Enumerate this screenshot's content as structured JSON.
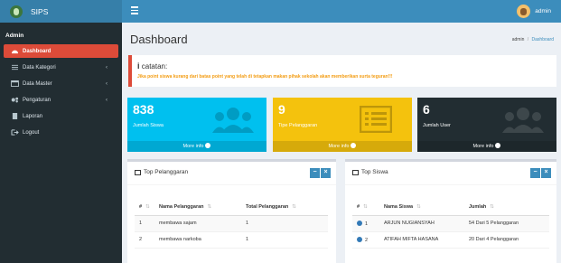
{
  "app": {
    "name": "SIPS"
  },
  "sidebar": {
    "header": "Admin",
    "items": [
      {
        "label": "Dashboard",
        "icon": "dashboard-icon"
      },
      {
        "label": "Data Kategori",
        "icon": "list-icon"
      },
      {
        "label": "Data Master",
        "icon": "table-icon"
      },
      {
        "label": "Pengaturan",
        "icon": "gears-icon"
      },
      {
        "label": "Laporan",
        "icon": "document-icon"
      },
      {
        "label": "Logout",
        "icon": "logout-icon"
      }
    ]
  },
  "topbar": {
    "user": "admin"
  },
  "page": {
    "title": "Dashboard",
    "breadcrumb": [
      "admin",
      "Dashboard"
    ]
  },
  "callout": {
    "title": "catatan:",
    "text": "Jika point siswa kurang dari batas point yang telah di tetapkan makan pihak sekolah akan memberikan surta teguran!!!"
  },
  "stats": [
    {
      "value": "838",
      "label": "Jumlah Siswa",
      "more": "More info",
      "color": "#00c0ef",
      "icon": "users-icon"
    },
    {
      "value": "9",
      "label": "Tipe Pelanggaran",
      "more": "More info",
      "color": "#f4c20d",
      "icon": "list-alt-icon"
    },
    {
      "value": "6",
      "label": "Jumlah User",
      "more": "More info",
      "color": "#222d32",
      "icon": "users-icon"
    }
  ],
  "top_pelanggaran": {
    "title": "Top Pelanggaran",
    "columns": [
      "#",
      "Nama Pelanggaran",
      "Total Pelanggaran"
    ],
    "rows": [
      [
        "1",
        "membawa sajam",
        "1"
      ],
      [
        "2",
        "membawa narkoba",
        "1"
      ]
    ]
  },
  "top_siswa": {
    "title": "Top Siswa",
    "columns": [
      "#",
      "Nama Siswa",
      "Jumlah"
    ],
    "rows": [
      [
        "1",
        "ARJUN NUGIANSYAH",
        "54 Dari 5 Pelanggaran"
      ],
      [
        "2",
        "ATIFAH MIFTA HASANA",
        "20 Dari 4 Pelanggaran"
      ]
    ]
  }
}
